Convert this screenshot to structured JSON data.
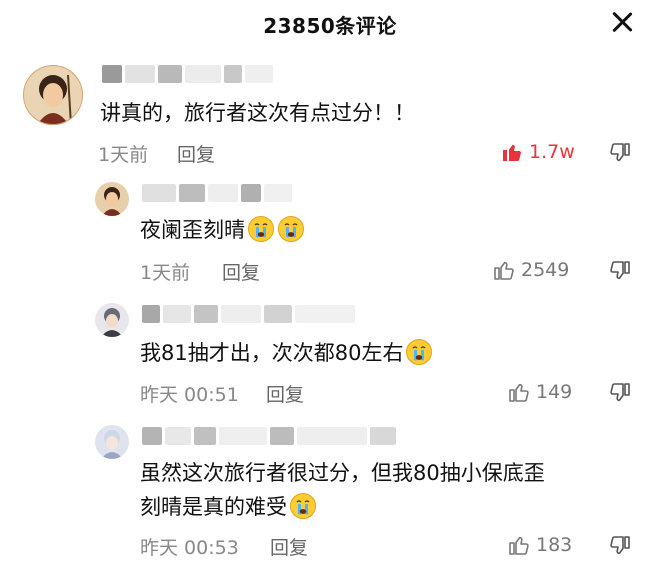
{
  "header": {
    "title": "23850条评论"
  },
  "comments": [
    {
      "text": "讲真的，旅行者这次有点过分！！",
      "time": "1天前",
      "reply_label": "回复",
      "likes": "1.7w",
      "liked": true
    },
    {
      "text": "夜阑歪刻晴",
      "time": "1天前",
      "reply_label": "回复",
      "likes": "2549"
    },
    {
      "text": "我81抽才出，次次都80左右",
      "time": "昨天 00:51",
      "reply_label": "回复",
      "likes": "149"
    },
    {
      "text_line1": "虽然这次旅行者很过分，但我80抽小保底歪",
      "text_line2": "刻晴是真的难受",
      "time": "昨天 00:53",
      "reply_label": "回复",
      "likes": "183"
    }
  ],
  "colors": {
    "liked": "#e8323c",
    "meta": "#888888",
    "text": "#111111"
  },
  "icons": [
    "close-icon",
    "thumb-up-icon",
    "thumb-down-icon",
    "crying-face-emoji"
  ]
}
